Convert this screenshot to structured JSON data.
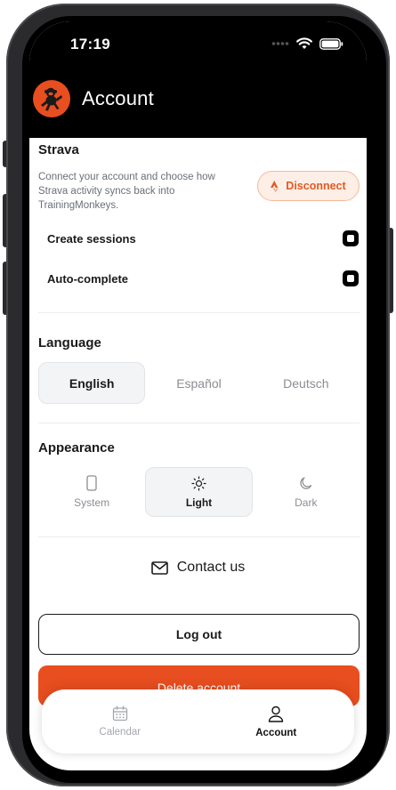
{
  "status_bar": {
    "time": "17:19"
  },
  "header": {
    "title": "Account"
  },
  "strava": {
    "title": "Strava",
    "description": "Connect your account and choose how Strava activity syncs back into TrainingMonkeys.",
    "disconnect_label": "Disconnect",
    "toggles": [
      {
        "label": "Create sessions",
        "checked": true
      },
      {
        "label": "Auto-complete",
        "checked": true
      }
    ]
  },
  "language": {
    "title": "Language",
    "options": [
      "English",
      "Español",
      "Deutsch"
    ],
    "selected": "English"
  },
  "appearance": {
    "title": "Appearance",
    "options": [
      {
        "label": "System",
        "icon": "phone-icon"
      },
      {
        "label": "Light",
        "icon": "sun-icon"
      },
      {
        "label": "Dark",
        "icon": "moon-icon"
      }
    ],
    "selected": "Light"
  },
  "contact": {
    "label": "Contact us",
    "icon": "mail-icon"
  },
  "actions": {
    "logout_label": "Log out",
    "delete_label": "Delete account"
  },
  "tabbar": {
    "tabs": [
      {
        "label": "Calendar",
        "icon": "calendar-icon",
        "active": false
      },
      {
        "label": "Account",
        "icon": "user-icon",
        "active": true
      }
    ]
  },
  "colors": {
    "accent": "#e84e1f",
    "header_bg": "#000000",
    "disconnect_bg": "#fdeee6",
    "disconnect_text": "#e15a24"
  }
}
